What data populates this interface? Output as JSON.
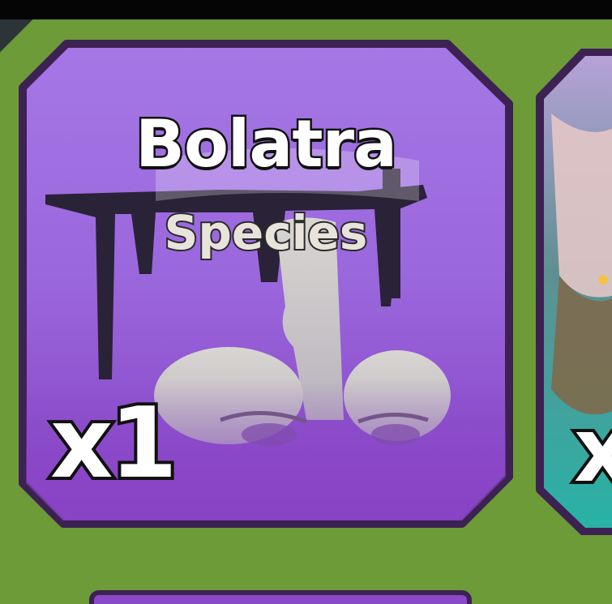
{
  "inventory": {
    "items": [
      {
        "name": "Bolatra",
        "category": "Species",
        "quantity": "x1",
        "rarity_color": "#8a4fd0"
      },
      {
        "quantity": "x",
        "rarity_color": "#30b7a8"
      }
    ]
  },
  "colors": {
    "background": "#6c9b37",
    "card_border": "#3d2153",
    "card_fill_top": "#a06ee0",
    "card_fill_bottom": "#8745c4"
  },
  "icons": {
    "main_item_art": "bolatra-creature-icon",
    "side_item_art": "partial-creature-icon"
  }
}
